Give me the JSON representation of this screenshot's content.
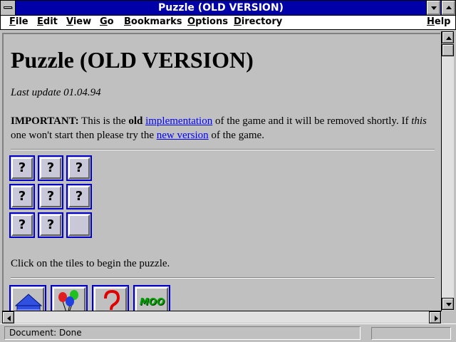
{
  "window": {
    "title": "Puzzle (OLD VERSION)"
  },
  "menu": {
    "items": [
      "File",
      "Edit",
      "View",
      "Go",
      "Bookmarks",
      "Options",
      "Directory",
      "Help"
    ]
  },
  "page": {
    "heading": "Puzzle (OLD VERSION)",
    "last_update": "Last update 01.04.94",
    "important_label": "IMPORTANT:",
    "important_t1": " This is the ",
    "important_old": "old",
    "important_t2": " ",
    "important_link1": "implementation",
    "important_t3": " of the game and it will be removed shortly. If ",
    "important_this": "this",
    "important_t4": " one won't start then please try the ",
    "important_link2": "new version",
    "important_t5": " of the game.",
    "tiles": [
      "?",
      "?",
      "?",
      "?",
      "?",
      "?",
      "?",
      "?",
      ""
    ],
    "instructions": "Click on the tiles to begin the puzzle.",
    "moo_label": "MOO"
  },
  "icons": {
    "nav": [
      "home-icon",
      "balloons-icon",
      "help-icon",
      "moo-icon"
    ]
  },
  "colors": {
    "title_bar": "#0000a8",
    "link": "#0000ff",
    "tile_border": "#0000c8"
  },
  "status": {
    "text": "Document: Done"
  }
}
